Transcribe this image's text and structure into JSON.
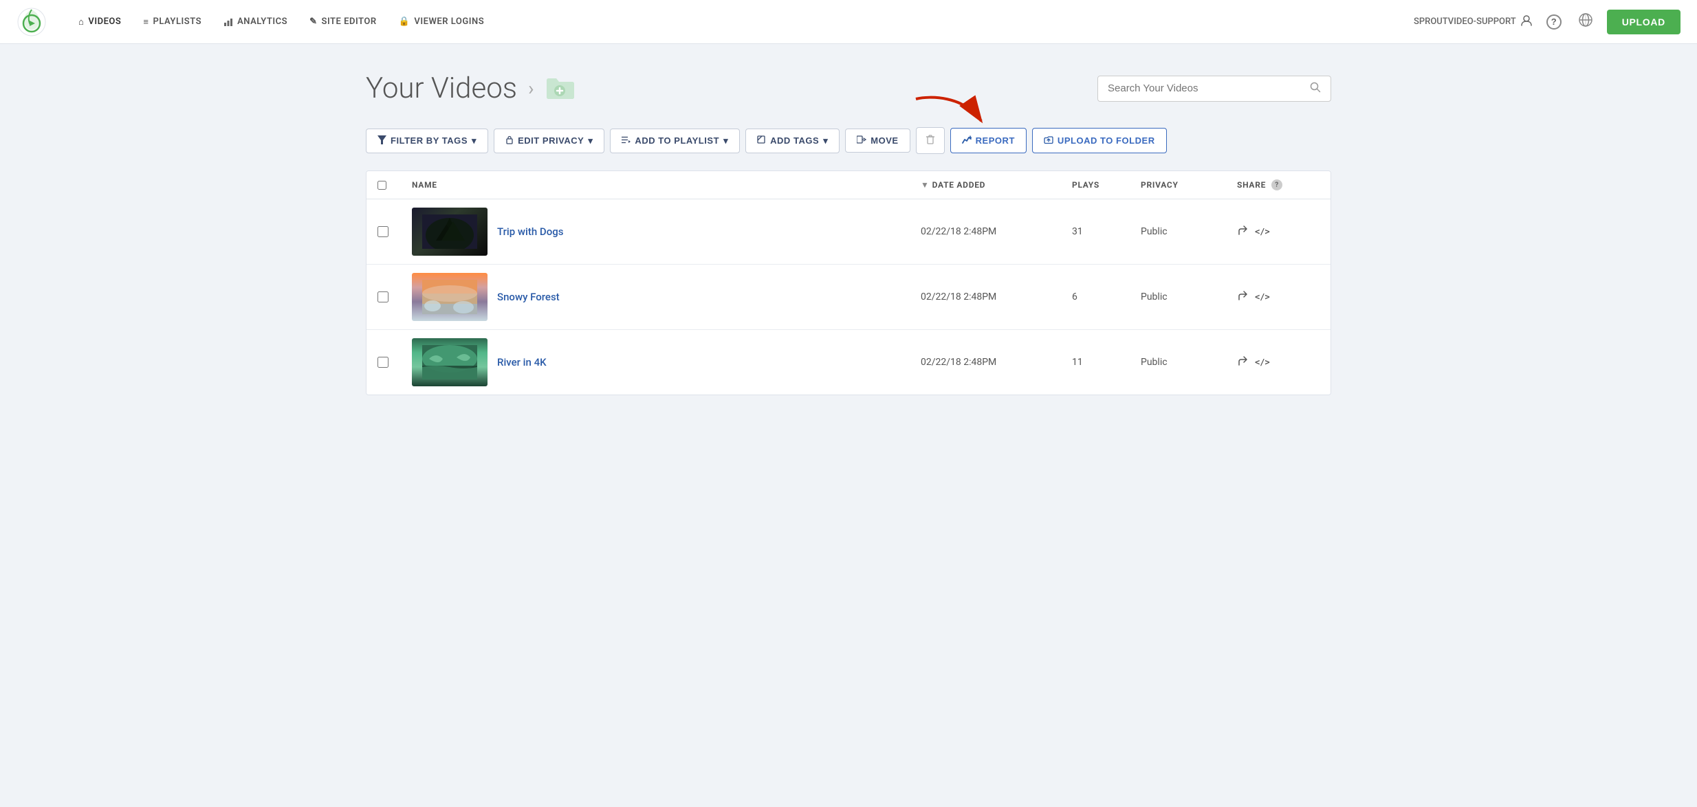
{
  "nav": {
    "links": [
      {
        "id": "videos",
        "label": "VIDEOS",
        "icon": "home",
        "active": true
      },
      {
        "id": "playlists",
        "label": "PLAYLISTS",
        "icon": "list"
      },
      {
        "id": "analytics",
        "label": "ANALYTICS",
        "icon": "bar-chart"
      },
      {
        "id": "site-editor",
        "label": "SITE EDITOR",
        "icon": "pencil"
      },
      {
        "id": "viewer-logins",
        "label": "VIEWER LOGINS",
        "icon": "lock"
      }
    ],
    "user": "SPROUTVIDEO-SUPPORT",
    "upload_label": "UPLOAD"
  },
  "page": {
    "title": "Your Videos",
    "breadcrumb_sep": "›",
    "search_placeholder": "Search Your Videos"
  },
  "toolbar": {
    "filter_tags": "FILTER BY TAGS",
    "edit_privacy": "EDIT PRIVACY",
    "add_to_playlist": "ADD TO PLAYLIST",
    "add_tags": "ADD TAGS",
    "move": "MOVE",
    "report": "REPORT",
    "upload_to_folder": "UPLOAD TO FOLDER"
  },
  "table": {
    "columns": [
      "",
      "NAME",
      "DATE ADDED",
      "PLAYS",
      "PRIVACY",
      "SHARE"
    ],
    "sort_col": "DATE ADDED",
    "rows": [
      {
        "id": 1,
        "name": "Trip with Dogs",
        "date": "02/22/18 2:48PM",
        "plays": "31",
        "privacy": "Public",
        "thumb_class": "thumb-1"
      },
      {
        "id": 2,
        "name": "Snowy Forest",
        "date": "02/22/18 2:48PM",
        "plays": "6",
        "privacy": "Public",
        "thumb_class": "thumb-2"
      },
      {
        "id": 3,
        "name": "River in 4K",
        "date": "02/22/18 2:48PM",
        "plays": "11",
        "privacy": "Public",
        "thumb_class": "thumb-3"
      }
    ]
  },
  "icons": {
    "home": "⌂",
    "search": "🔍",
    "question": "?",
    "globe": "🌐",
    "user": "👤",
    "filter": "⧖",
    "lock": "🔒",
    "list": "≡",
    "chart": "📊",
    "pencil": "✎",
    "tag": "🏷",
    "move": "➡",
    "trash": "🗑",
    "report": "📈",
    "upload_folder": "⬆",
    "share": "↗",
    "embed": "</>",
    "sort_down": "▼",
    "folder_plus": "📁",
    "play_arrow": "▶"
  },
  "colors": {
    "accent_green": "#4caf50",
    "accent_blue": "#2a5ba8",
    "nav_bg": "#ffffff",
    "page_bg": "#f0f3f7",
    "table_bg": "#ffffff",
    "border": "#dde2ea"
  }
}
